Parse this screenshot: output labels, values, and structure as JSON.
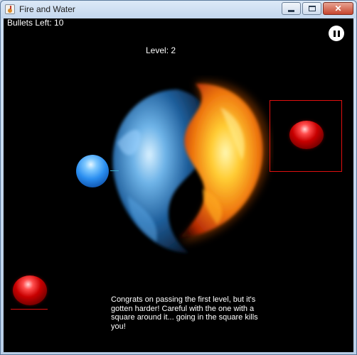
{
  "window": {
    "title": "Fire and Water",
    "controls": {
      "minimize": "minimize-icon",
      "maximize": "maximize-icon",
      "close": "✕"
    }
  },
  "hud": {
    "bullets": "Bullets Left: 10",
    "level": "Level: 2",
    "pause_icon": "pause-icon"
  },
  "message": "Congrats on passing the first level, but it's gotten harder! Careful with the one with a square around it... going in the square kills you!",
  "colors": {
    "canvas": "#000000",
    "enemy_red": "#c80000",
    "ally_blue": "#2a8ef0",
    "square": "#e01010"
  }
}
